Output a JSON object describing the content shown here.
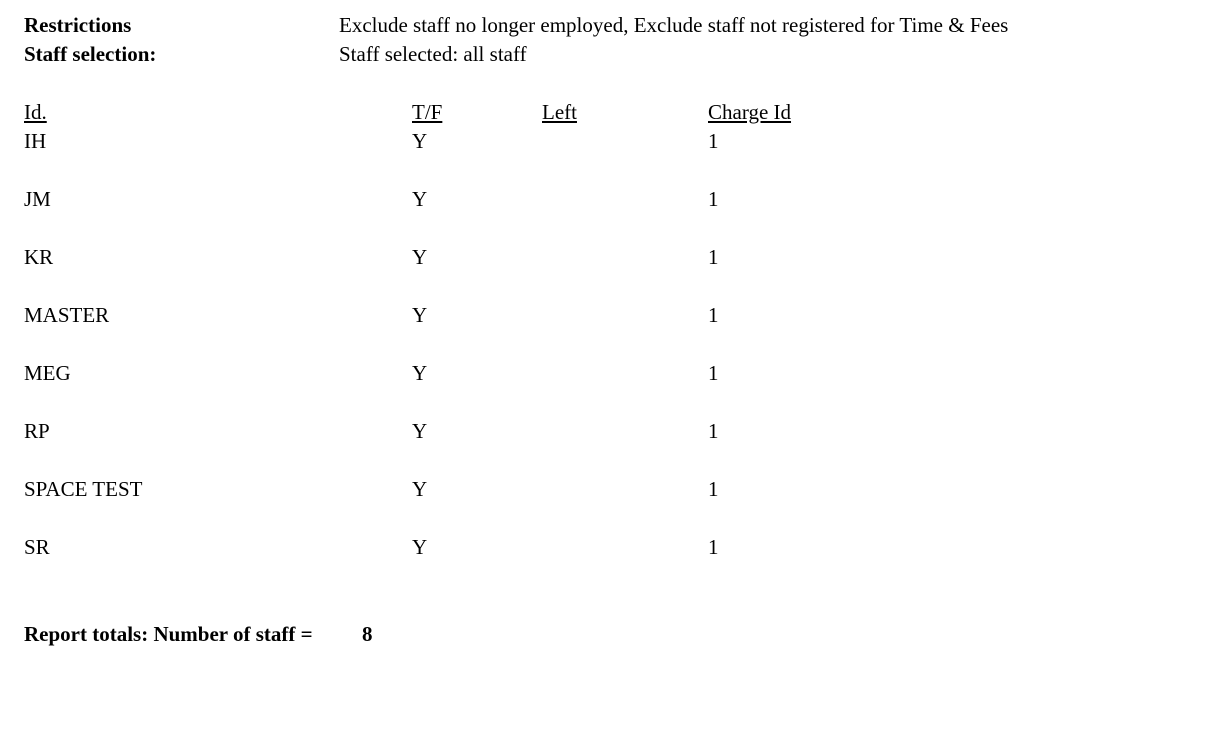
{
  "header": {
    "restrictions_label": "Restrictions",
    "restrictions_value": "Exclude staff no longer employed, Exclude staff not registered for Time & Fees",
    "selection_label": "Staff selection:",
    "selection_value": "Staff selected: all staff"
  },
  "table": {
    "columns": [
      "Id.",
      "T/F",
      "Left",
      "Charge Id"
    ],
    "rows": [
      {
        "id": "IH",
        "tf": "Y",
        "left": "",
        "charge_id": "1"
      },
      {
        "id": "JM",
        "tf": "Y",
        "left": "",
        "charge_id": "1"
      },
      {
        "id": "KR",
        "tf": "Y",
        "left": "",
        "charge_id": "1"
      },
      {
        "id": "MASTER",
        "tf": "Y",
        "left": "",
        "charge_id": "1"
      },
      {
        "id": "MEG",
        "tf": "Y",
        "left": "",
        "charge_id": "1"
      },
      {
        "id": "RP",
        "tf": "Y",
        "left": "",
        "charge_id": "1"
      },
      {
        "id": "SPACE TEST",
        "tf": "Y",
        "left": "",
        "charge_id": "1"
      },
      {
        "id": "SR",
        "tf": "Y",
        "left": "",
        "charge_id": "1"
      }
    ]
  },
  "totals": {
    "label": "Report totals: Number of staff =",
    "value": "8"
  }
}
